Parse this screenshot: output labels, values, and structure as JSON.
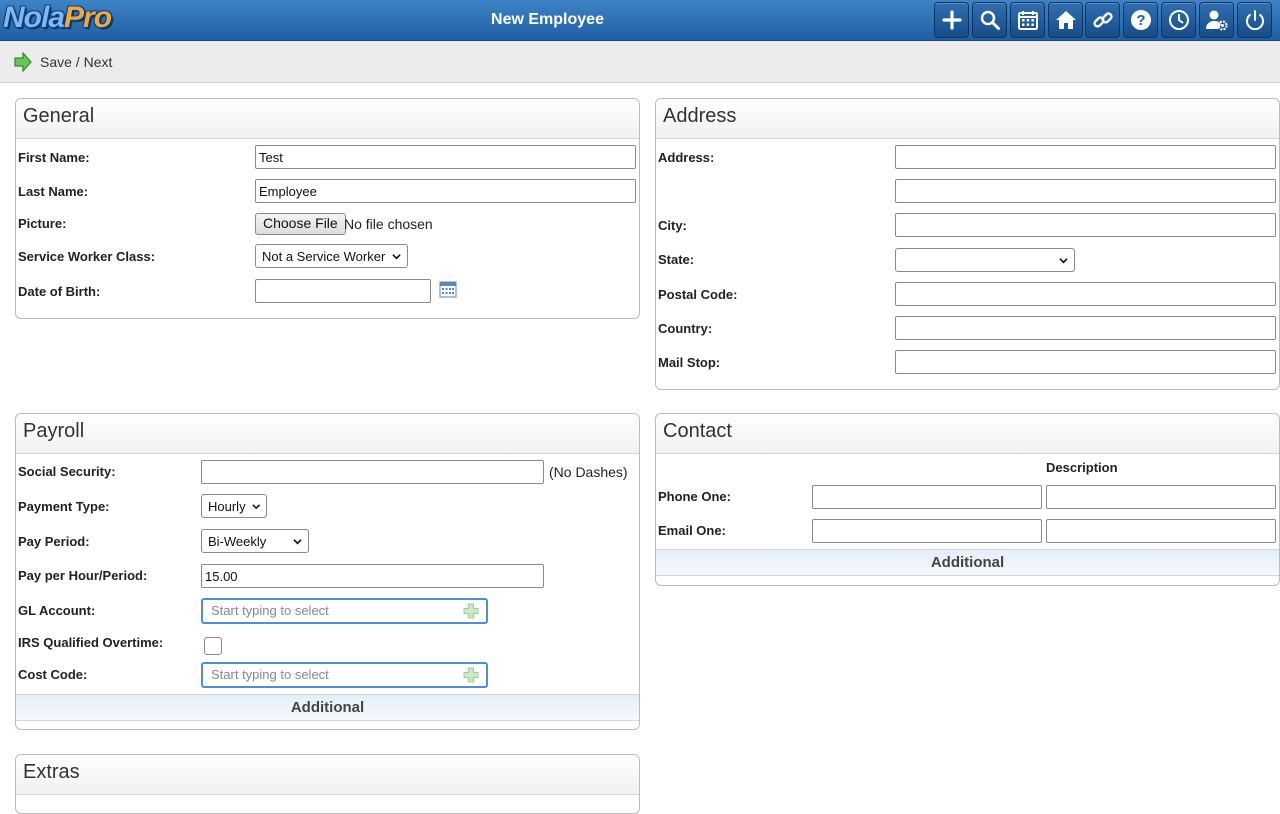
{
  "app": {
    "logo_part1": "Nola",
    "logo_part2": "Pro",
    "page_title": "New Employee",
    "toolbar_icons": [
      "plus-icon",
      "search-icon",
      "calendar-icon",
      "home-icon",
      "link-icon",
      "help-icon",
      "clock-icon",
      "user-settings-icon",
      "power-icon"
    ]
  },
  "actions": {
    "save_next": "Save / Next"
  },
  "general": {
    "title": "General",
    "first_name_label": "First Name:",
    "first_name_value": "Test",
    "last_name_label": "Last Name:",
    "last_name_value": "Employee",
    "picture_label": "Picture:",
    "choose_file": "Choose File",
    "no_file": "No file chosen",
    "service_class_label": "Service Worker Class:",
    "service_class_value": "Not a Service Worker",
    "dob_label": "Date of Birth:",
    "dob_value": ""
  },
  "address": {
    "title": "Address",
    "address_label": "Address:",
    "city_label": "City:",
    "state_label": "State:",
    "state_value": "",
    "postal_label": "Postal Code:",
    "country_label": "Country:",
    "mailstop_label": "Mail Stop:"
  },
  "payroll": {
    "title": "Payroll",
    "ssn_label": "Social Security:",
    "ssn_value": "",
    "ssn_hint": "(No Dashes)",
    "payment_type_label": "Payment Type:",
    "payment_type_value": "Hourly",
    "pay_period_label": "Pay Period:",
    "pay_period_value": "Bi-Weekly",
    "pay_rate_label": "Pay per Hour/Period:",
    "pay_rate_value": "15.00",
    "gl_label": "GL Account:",
    "gl_placeholder": "Start typing to select",
    "irs_label": "IRS Qualified Overtime:",
    "cost_code_label": "Cost Code:",
    "cost_code_placeholder": "Start typing to select",
    "additional": "Additional"
  },
  "contact": {
    "title": "Contact",
    "description_header": "Description",
    "phone_label": "Phone One:",
    "email_label": "Email One:",
    "additional": "Additional"
  },
  "extras": {
    "title": "Extras"
  },
  "colors": {
    "topbar": "#2a6db0",
    "accent_blue": "#4e8fd2",
    "save_green": "#3fa63a"
  }
}
